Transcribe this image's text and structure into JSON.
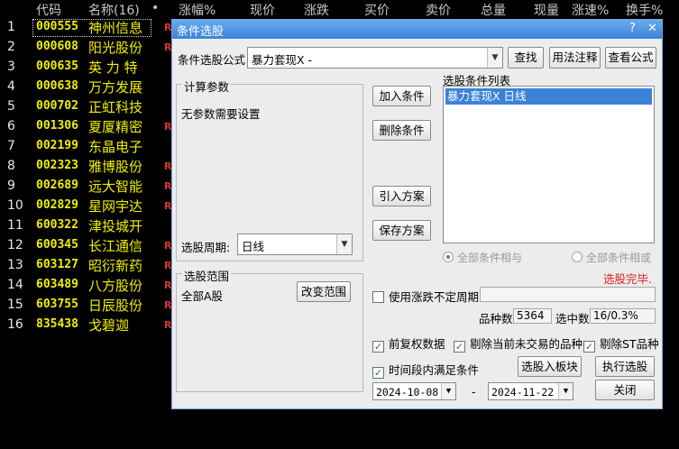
{
  "stock_table": {
    "headers": [
      "代码",
      "名称(16)",
      "•",
      "涨幅%",
      "现价",
      "涨跌",
      "买价",
      "卖价",
      "总量",
      "现量",
      "涨速%",
      "换手%"
    ],
    "rows": [
      {
        "index": "1",
        "code": "000555",
        "name": "神州信息",
        "mark": "R"
      },
      {
        "index": "2",
        "code": "000608",
        "name": "阳光股份",
        "mark": "R"
      },
      {
        "index": "3",
        "code": "000635",
        "name": "英 力 特",
        "mark": ""
      },
      {
        "index": "4",
        "code": "000638",
        "name": "万方发展",
        "mark": ""
      },
      {
        "index": "5",
        "code": "000702",
        "name": "正虹科技",
        "mark": ""
      },
      {
        "index": "6",
        "code": "001306",
        "name": "夏厦精密",
        "mark": "R"
      },
      {
        "index": "7",
        "code": "002199",
        "name": "东晶电子",
        "mark": ""
      },
      {
        "index": "8",
        "code": "002323",
        "name": "雅博股份",
        "mark": "R"
      },
      {
        "index": "9",
        "code": "002689",
        "name": "远大智能",
        "mark": "R"
      },
      {
        "index": "10",
        "code": "002829",
        "name": "星网宇达",
        "mark": "R"
      },
      {
        "index": "11",
        "code": "600322",
        "name": "津投城开",
        "mark": ""
      },
      {
        "index": "12",
        "code": "600345",
        "name": "长江通信",
        "mark": "R"
      },
      {
        "index": "13",
        "code": "603127",
        "name": "昭衍新药",
        "mark": "R"
      },
      {
        "index": "14",
        "code": "603489",
        "name": "八方股份",
        "mark": "R"
      },
      {
        "index": "15",
        "code": "603755",
        "name": "日辰股份",
        "mark": "R"
      },
      {
        "index": "16",
        "code": "835438",
        "name": "戈碧迦",
        "mark": "R"
      }
    ]
  },
  "dialog": {
    "title": "条件选股",
    "help_btn": "?",
    "close_btn": "✕",
    "formula_label": "条件选股公式",
    "formula_value": "暴力套现X    -",
    "find_btn": "查找",
    "usage_btn": "用法注释",
    "view_formula_btn": "查看公式",
    "params_title": "计算参数",
    "params_text": "无参数需要设置",
    "period_label": "选股周期:",
    "period_value": "日线",
    "add_btn": "加入条件",
    "delete_btn": "删除条件",
    "import_btn": "引入方案",
    "save_btn": "保存方案",
    "list_title": "选股条件列表",
    "list_items": [
      "暴力套现X  日线"
    ],
    "radio_and": "全部条件相与",
    "radio_or": "全部条件相或",
    "status_text": "选股完毕.",
    "scope_title": "选股范围",
    "scope_value": "全部A股",
    "change_scope_btn": "改变范围",
    "use_period_label": "使用涨跌不定周期",
    "count_label": "品种数",
    "count_value": "5364",
    "selected_label": "选中数",
    "selected_value": "16/0.3%",
    "chk_rights": "前复权数据",
    "chk_remove_untraded": "剔除当前未交易的品种",
    "chk_remove_st": "剔除ST品种",
    "chk_in_period": "时间段内满足条件",
    "to_block_btn": "选股入板块",
    "execute_btn": "执行选股",
    "date_from": "2024-10-08",
    "date_sep": "-",
    "date_to": "2024-11-22",
    "close_dialog_btn": "关闭"
  },
  "colors": {
    "stock_text": "#f0f000",
    "title_bar": "#3b82d8",
    "status": "#e02020"
  }
}
